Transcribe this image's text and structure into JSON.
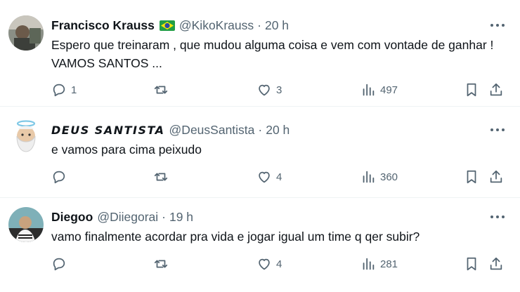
{
  "tweets": [
    {
      "name": "Francisco Krauss",
      "handle": "@KikoKrauss",
      "separator": "·",
      "time": "20 h",
      "text": "Espero que treinaram , que mudou alguma coisa e vem com vontade de ganhar ! VAMOS SANTOS ...",
      "replies": "1",
      "retweets": "",
      "likes": "3",
      "views": "497",
      "has_flag": "brazil-flag-icon"
    },
    {
      "name": "DEUS SANTISTA",
      "handle": "@DeusSantista",
      "separator": "·",
      "time": "20 h",
      "text": "e vamos para cima peixudo",
      "replies": "",
      "retweets": "",
      "likes": "4",
      "views": "360"
    },
    {
      "name": "Diegoo",
      "handle": "@Diiegorai",
      "separator": "·",
      "time": "19 h",
      "text": "vamo finalmente acordar pra vida e jogar igual um time q qer subir?",
      "replies": "",
      "retweets": "",
      "likes": "4",
      "views": "281"
    }
  ],
  "colors": {
    "text": "#0f1419",
    "secondary": "#536471",
    "divider": "#eff3f4"
  }
}
